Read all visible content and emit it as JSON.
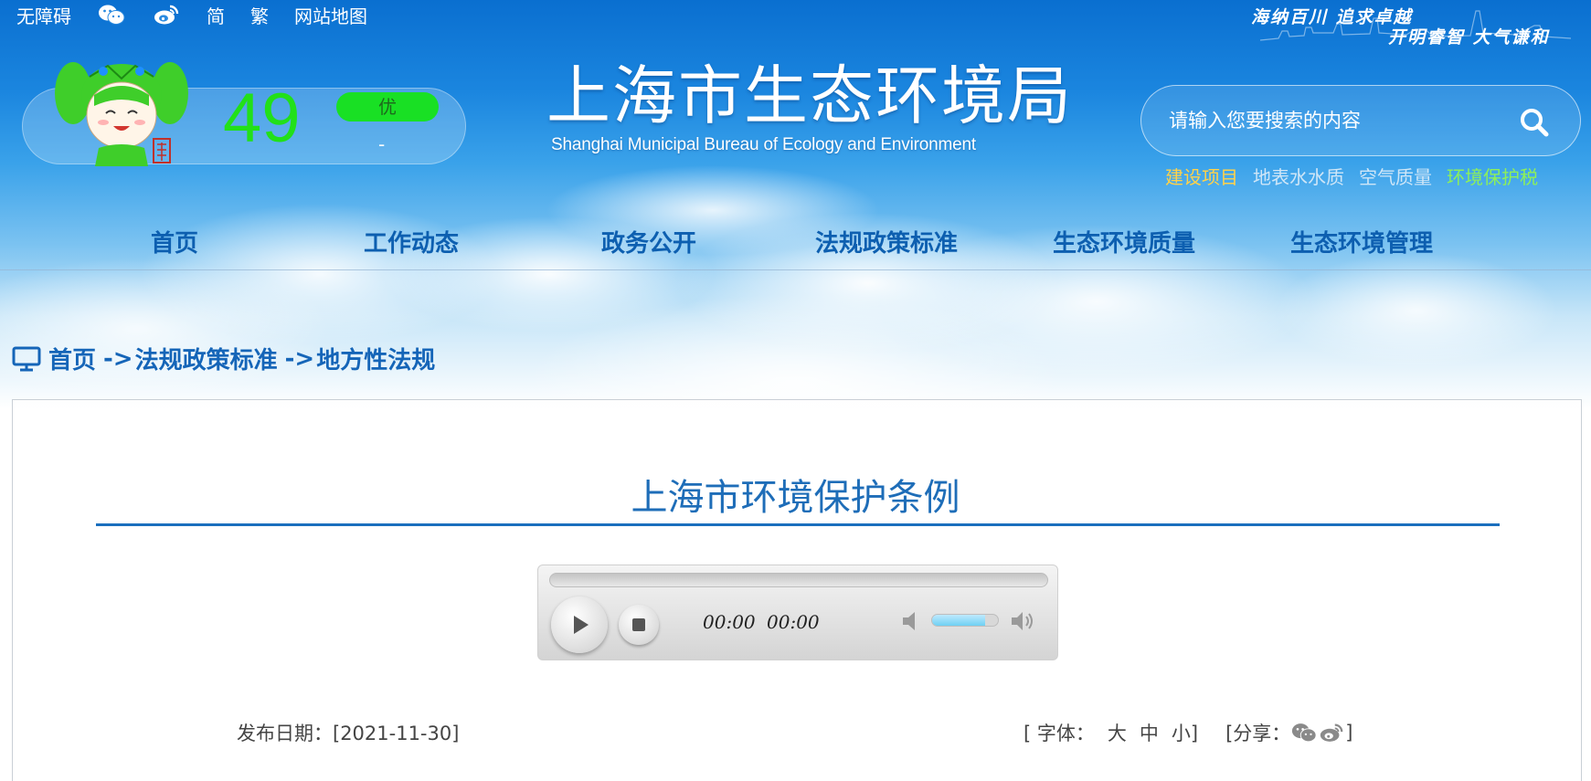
{
  "topbar": {
    "accessibility": "无障碍",
    "wechat_icon": "wechat-icon",
    "weibo_icon": "weibo-icon",
    "simplified": "简",
    "traditional": "繁",
    "sitemap": "网站地图"
  },
  "slogan": {
    "line1": "海纳百川 追求卓越",
    "line2": "开明睿智 大气谦和"
  },
  "aqi": {
    "value": "49",
    "level": "优",
    "pollutant": "-",
    "level_color": "#19e024",
    "value_color": "#22e019"
  },
  "logo": {
    "cn": "上海市生态环境局",
    "en": "Shanghai Municipal Bureau of Ecology and Environment"
  },
  "search": {
    "placeholder": "请输入您要搜索的内容",
    "icon": "search-icon"
  },
  "quick_links": [
    {
      "label": "建设项目",
      "color": "#ffd24a"
    },
    {
      "label": "地表水水质",
      "color": "#cfe6f7"
    },
    {
      "label": "空气质量",
      "color": "#cfe6f7"
    },
    {
      "label": "环境保护税",
      "color": "#8df05a"
    }
  ],
  "nav": {
    "items": [
      "首页",
      "工作动态",
      "政务公开",
      "法规政策标准",
      "生态环境质量",
      "生态环境管理"
    ]
  },
  "breadcrumb": {
    "icon": "monitor-icon",
    "items": [
      "首页",
      "法规政策标准",
      "地方性法规"
    ],
    "separator": "->"
  },
  "article": {
    "title": "上海市环境保护条例"
  },
  "player": {
    "current_time": "00:00",
    "duration": "00:00",
    "progress": 0,
    "volume": 0.8
  },
  "meta": {
    "publish_label": "发布日期：",
    "publish_date": "[2021-11-30]",
    "font_label": "[ 字体：",
    "font_large": "大",
    "font_medium": "中",
    "font_small": "小]",
    "share_label": "[分享：",
    "share_end": "]"
  }
}
